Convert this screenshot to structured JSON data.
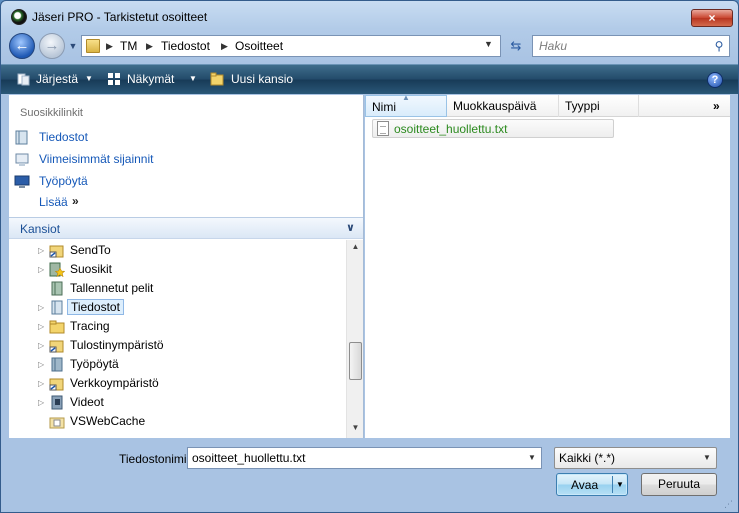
{
  "window": {
    "title": "Jäseri PRO - Tarkistetut osoitteet",
    "close_glyph": "×"
  },
  "nav": {
    "back_glyph": "←",
    "forward_glyph": "→"
  },
  "address": {
    "breadcrumbs": [
      "TM",
      "Tiedostot",
      "Osoitteet"
    ]
  },
  "search": {
    "placeholder": "Haku"
  },
  "toolbar": {
    "organize_label": "Järjestä",
    "views_label": "Näkymät",
    "new_folder_label": "Uusi kansio",
    "help_glyph": "?"
  },
  "favorites": {
    "header": "Suosikkilinkit",
    "items": [
      {
        "label": "Tiedostot",
        "icon": "documents-icon"
      },
      {
        "label": "Viimeisimmät sijainnit",
        "icon": "recent-places-icon"
      },
      {
        "label": "Työpöytä",
        "icon": "desktop-icon"
      }
    ],
    "more_label": "Lisää",
    "more_arrows": "»"
  },
  "folders": {
    "header": "Kansiot",
    "items": [
      {
        "label": "SendTo",
        "expandable": true,
        "icon": "shortcut-folder-icon"
      },
      {
        "label": "Suosikit",
        "expandable": true,
        "icon": "favorites-folder-icon"
      },
      {
        "label": "Tallennetut pelit",
        "expandable": false,
        "icon": "saved-games-icon"
      },
      {
        "label": "Tiedostot",
        "expandable": true,
        "icon": "documents-icon",
        "selected": true
      },
      {
        "label": "Tracing",
        "expandable": true,
        "icon": "folder-icon"
      },
      {
        "label": "Tulostinympäristö",
        "expandable": true,
        "icon": "shortcut-folder-icon"
      },
      {
        "label": "Työpöytä",
        "expandable": true,
        "icon": "desktop-folder-icon"
      },
      {
        "label": "Verkkoympäristö",
        "expandable": true,
        "icon": "shortcut-folder-icon"
      },
      {
        "label": "Videot",
        "expandable": true,
        "icon": "videos-folder-icon"
      },
      {
        "label": "VSWebCache",
        "expandable": false,
        "icon": "system-folder-icon"
      }
    ]
  },
  "filelist": {
    "columns": [
      "Nimi",
      "Muokkauspäivä",
      "Tyyppi"
    ],
    "more": "»",
    "files": [
      {
        "name": "osoitteet_huollettu.txt"
      }
    ]
  },
  "footer": {
    "filename_label": "Tiedostonimi:",
    "filename_value": "osoitteet_huollettu.txt",
    "filter_value": "Kaikki (*.*)",
    "open_label": "Avaa",
    "cancel_label": "Peruuta"
  },
  "colors": {
    "link_blue": "#1558b8",
    "file_green": "#2c8a1f",
    "toolbar_dark": "#224a69"
  }
}
